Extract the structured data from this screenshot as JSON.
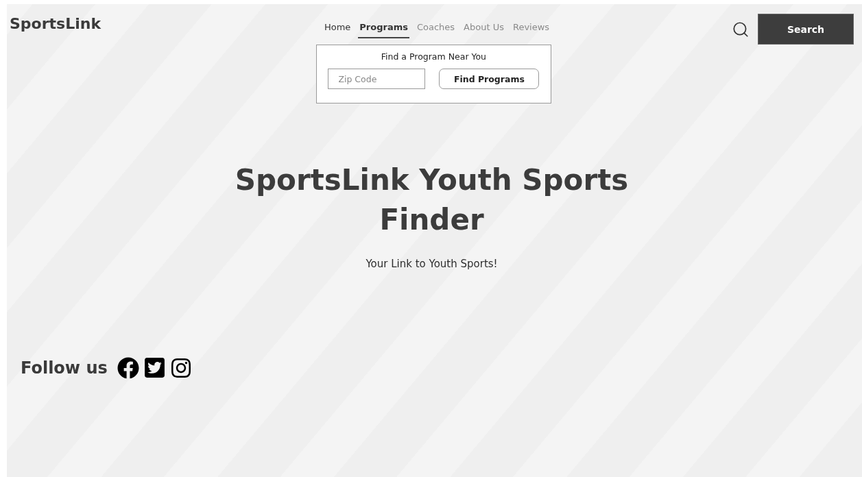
{
  "brand": "SportsLink",
  "nav": [
    {
      "label": "Home",
      "selected": false,
      "disabled": false
    },
    {
      "label": "Programs",
      "selected": true,
      "disabled": false
    },
    {
      "label": "Coaches",
      "selected": false,
      "disabled": true
    },
    {
      "label": "About Us",
      "selected": false,
      "disabled": true
    },
    {
      "label": "Reviews",
      "selected": false,
      "disabled": true
    }
  ],
  "dropdown": {
    "title": "Find a Program Near You",
    "placeholder": "Zip Code",
    "button": "Find Programs"
  },
  "search_button": "Search",
  "hero": {
    "title": "SportsLink Youth Sports Finder",
    "subtitle": "Your Link to Youth Sports!"
  },
  "follow": {
    "label": "Follow us",
    "links": [
      {
        "kind": "facebook"
      },
      {
        "kind": "twitter"
      },
      {
        "kind": "instagram"
      }
    ]
  }
}
